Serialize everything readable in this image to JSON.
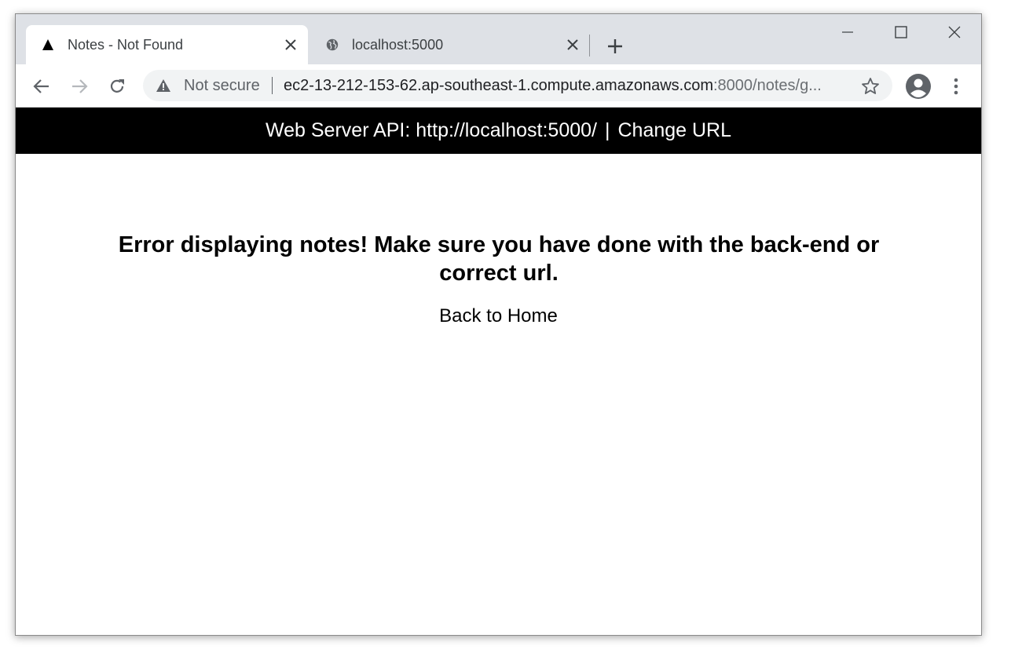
{
  "browser": {
    "tabs": [
      {
        "title": "Notes - Not Found",
        "icon": "triangle-logo-icon",
        "active": true
      },
      {
        "title": "localhost:5000",
        "icon": "globe-icon",
        "active": false
      }
    ],
    "address_bar": {
      "security_label": "Not secure",
      "url_main": "ec2-13-212-153-62.ap-southeast-1.compute.amazonaws.com",
      "url_rest": ":8000/notes/g..."
    }
  },
  "banner": {
    "api_label": "Web Server API: http://localhost:5000/",
    "separator": "|",
    "change_url": "Change URL"
  },
  "main": {
    "error_message": "Error displaying notes! Make sure you have done with the back-end or correct url.",
    "back_link": "Back to Home"
  },
  "colors": {
    "tabstrip_bg": "#dee1e6",
    "banner_bg": "#000000",
    "banner_text": "#ffffff"
  }
}
